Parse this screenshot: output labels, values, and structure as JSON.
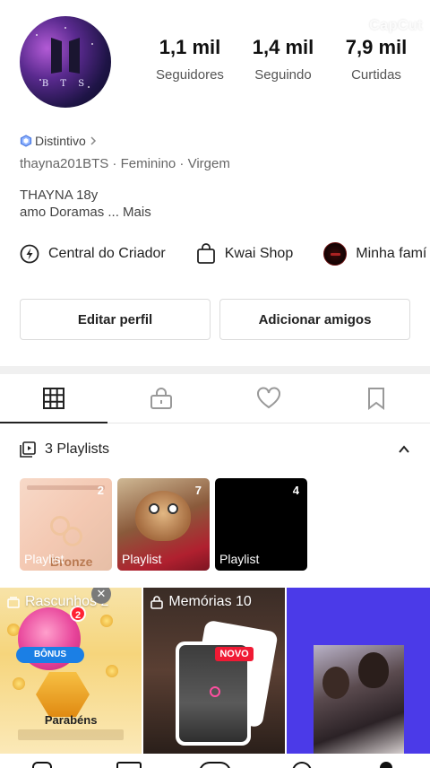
{
  "watermark": "CapCut",
  "profile": {
    "avatar_text": "B T S",
    "stats": [
      {
        "value": "1,1 mil",
        "label": "Seguidores"
      },
      {
        "value": "1,4 mil",
        "label": "Seguindo"
      },
      {
        "value": "7,9 mil",
        "label": "Curtidas"
      }
    ],
    "badge_label": "Distintivo",
    "info": "thayna201BTS · Feminino · Virgem",
    "bio_name": "THAYNA 18y",
    "bio_text": "amo Doramas ...",
    "bio_more": "Mais"
  },
  "links": [
    {
      "label": "Central do Criador",
      "icon": "lightning-circle-icon"
    },
    {
      "label": "Kwai Shop",
      "icon": "shopping-bag-icon"
    },
    {
      "label": "Minha famí",
      "icon": "family-avatar-icon"
    }
  ],
  "buttons": {
    "edit_profile": "Editar perfil",
    "add_friends": "Adicionar amigos"
  },
  "tabs": [
    {
      "icon": "grid-icon",
      "active": true
    },
    {
      "icon": "lock-icon",
      "active": false
    },
    {
      "icon": "heart-icon",
      "active": false
    },
    {
      "icon": "bookmark-icon",
      "active": false
    }
  ],
  "playlists": {
    "header": "3 Playlists",
    "items": [
      {
        "count": "2",
        "label": "Playlist",
        "overlay": "Bronze"
      },
      {
        "count": "7",
        "label": "Playlist"
      },
      {
        "count": "4",
        "label": "Playlist"
      }
    ]
  },
  "grid": {
    "drafts_label": "Rascunhos 2",
    "drafts_bonus": "BÔNUS",
    "drafts_notification": "2",
    "drafts_congrats": "Parabéns",
    "memories_label": "Memórias 10",
    "memories_badge": "NOVO"
  },
  "colors": {
    "accent_blue": "#4b3ae8",
    "new_badge": "#f01a34",
    "bonus_pill": "#1b7fe5"
  }
}
